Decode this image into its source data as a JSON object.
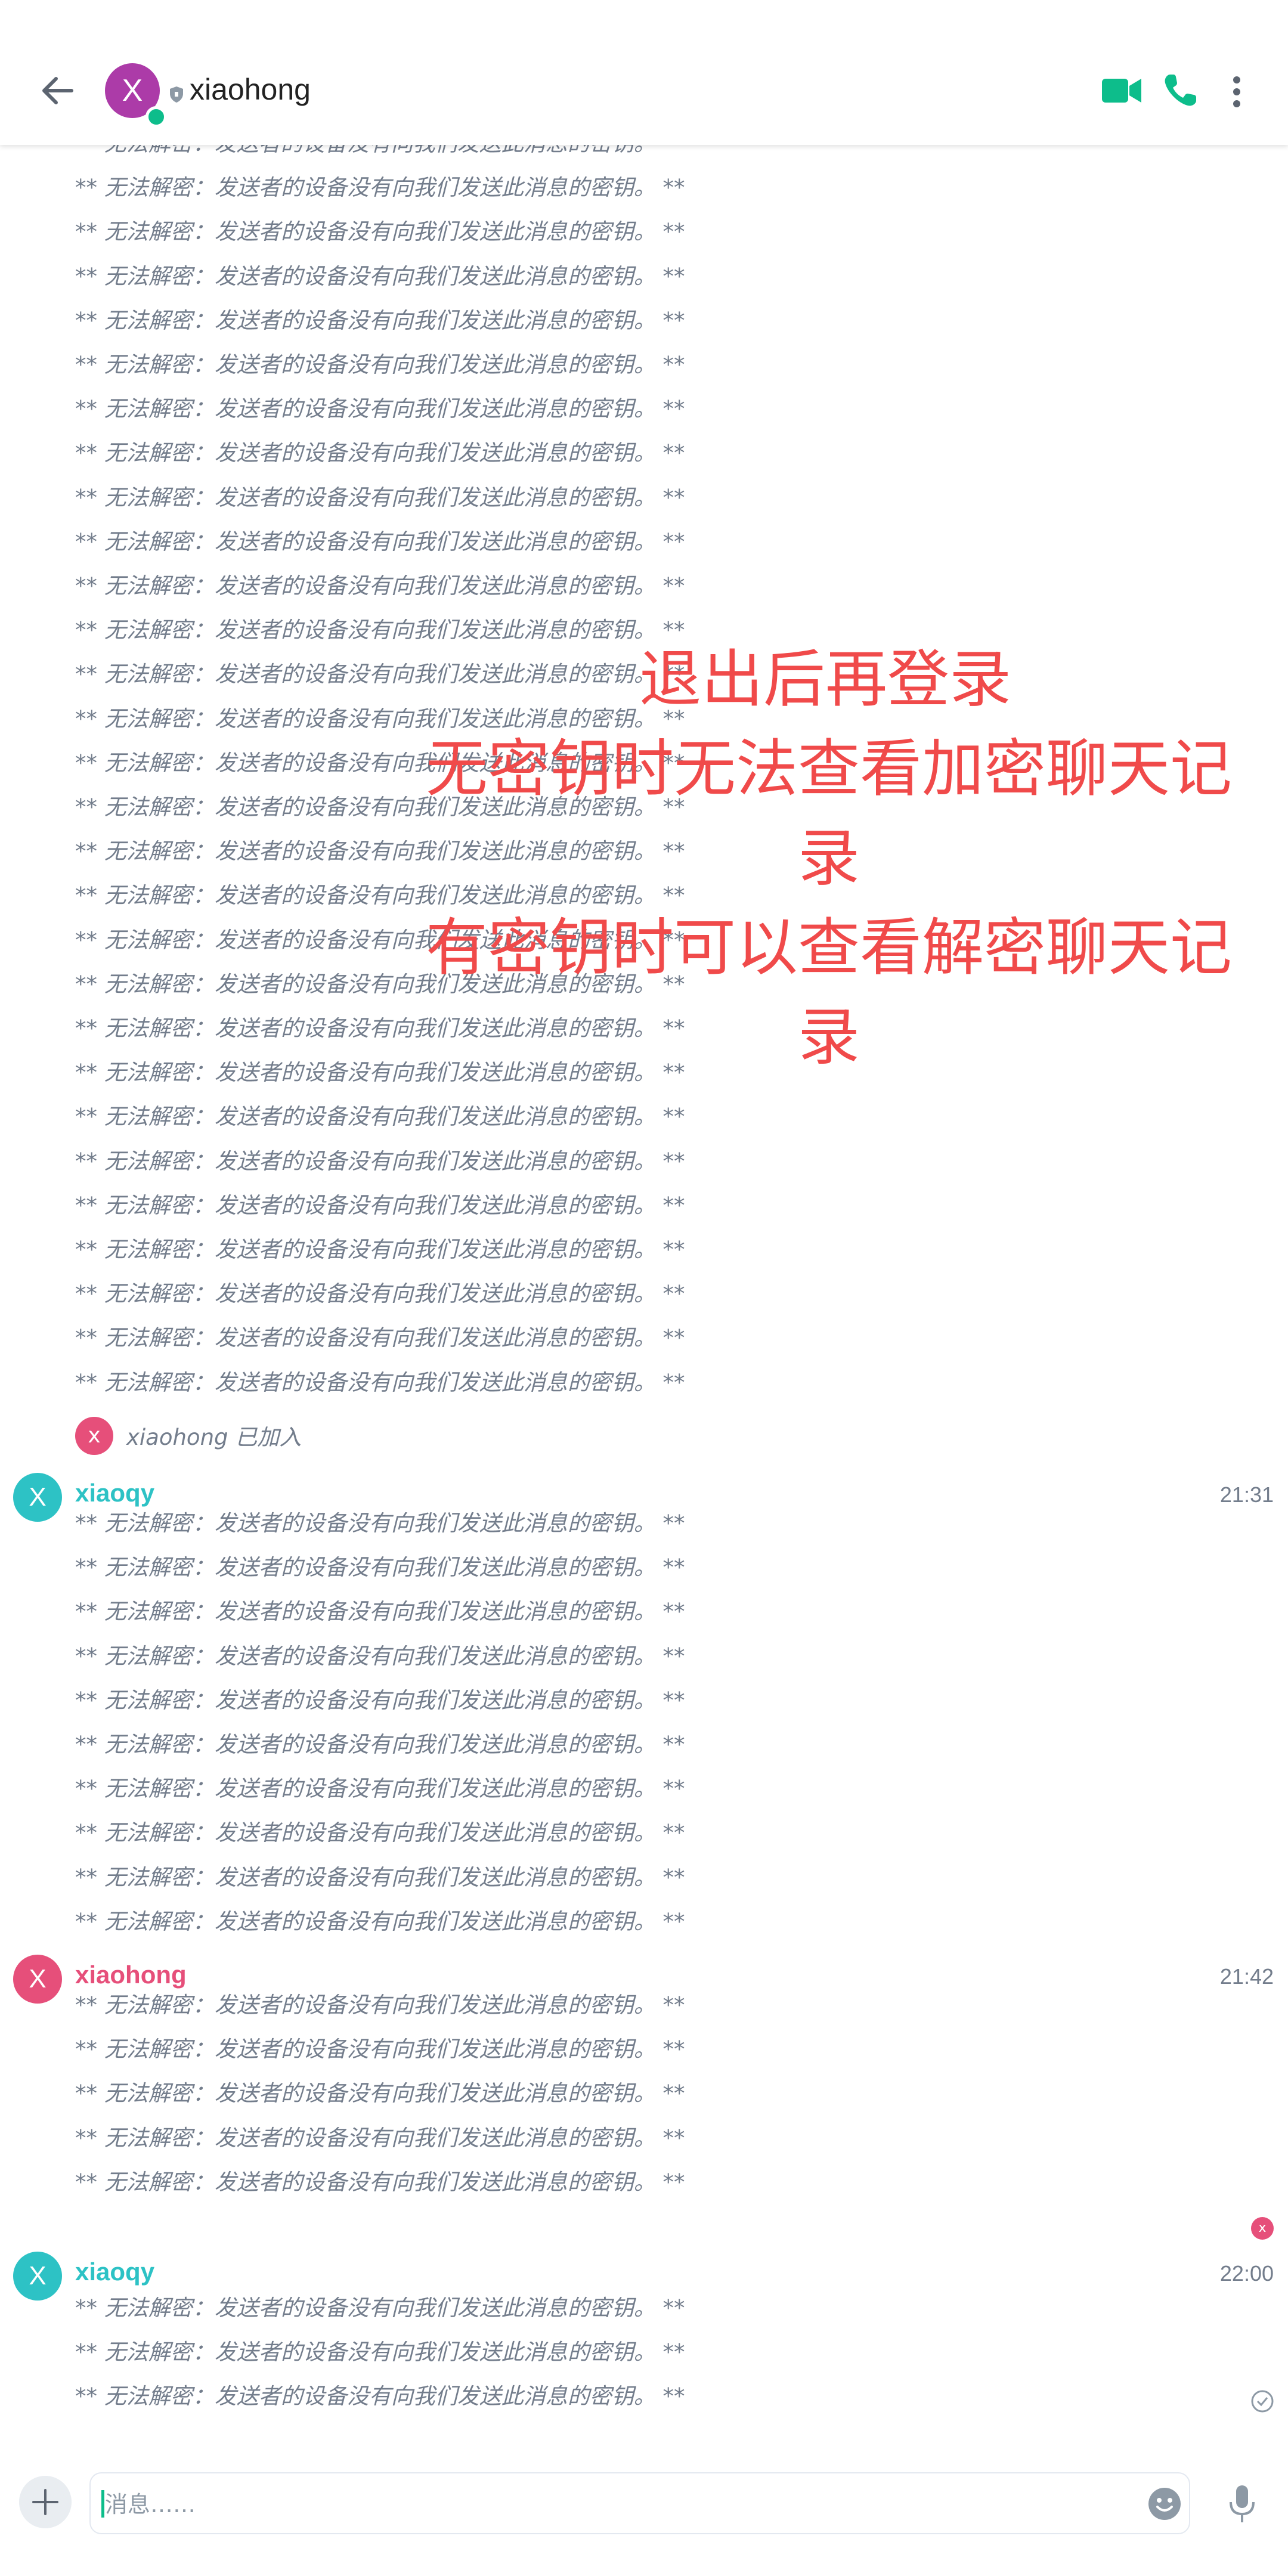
{
  "header": {
    "avatar_initial": "X",
    "room_name": "xiaohong"
  },
  "undecryptable_text": "** 无法解密：发送者的设备没有向我们发送此消息的密钥。 **",
  "member_event": {
    "avatar_initial": "x",
    "text": "xiaohong 已加入"
  },
  "groups": [
    {
      "sender": "xiaoqy",
      "avatar_initial": "X",
      "time": "21:31",
      "color": "teal",
      "message_count": 10
    },
    {
      "sender": "xiaohong",
      "avatar_initial": "X",
      "time": "21:42",
      "color": "pink",
      "message_count": 5
    },
    {
      "sender": "xiaoqy",
      "avatar_initial": "X",
      "time": "22:00",
      "color": "teal",
      "message_count": 3
    }
  ],
  "read_receipt_initial": "x",
  "annotation": {
    "line1": "退出后再登录",
    "line2": "无密钥时无法查看加密聊天记",
    "line3": "录",
    "line4": "有密钥时可以查看解密聊天记",
    "line5": "录"
  },
  "composer": {
    "placeholder": "消息……"
  },
  "colors": {
    "accent_green": "#0dbd8b",
    "teal_user": "#2dc2c5",
    "pink_user": "#e64f7a",
    "room_avatar": "#ac3ba8",
    "annotation_red": "#f04a4a"
  }
}
